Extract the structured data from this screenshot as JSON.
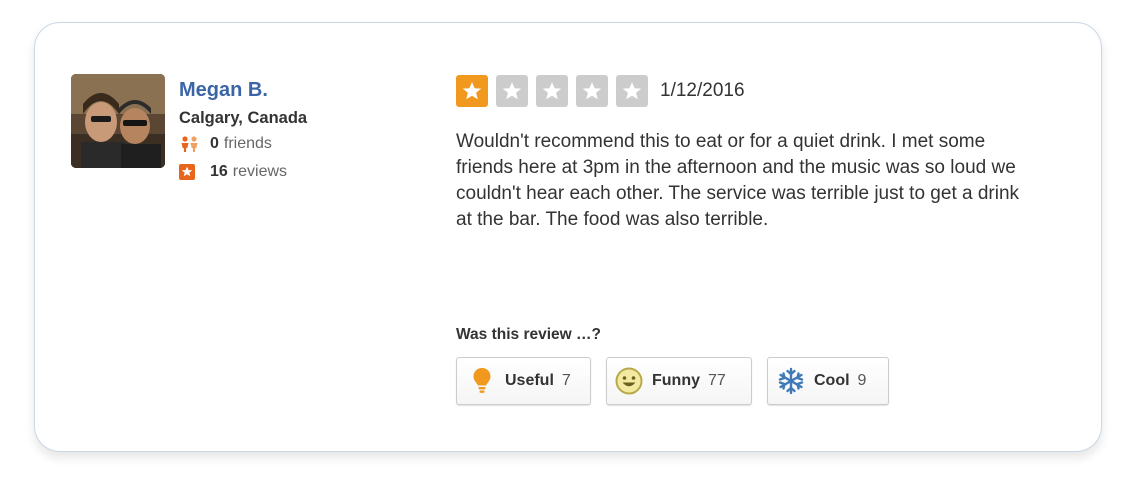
{
  "reviewer": {
    "name": "Megan B.",
    "location": "Calgary, Canada",
    "friends_count": "0",
    "friends_label": "friends",
    "reviews_count": "16",
    "reviews_label": "reviews"
  },
  "review": {
    "rating": 1,
    "max_rating": 5,
    "date": "1/12/2016",
    "text": "Wouldn't recommend this to eat or for a quiet drink. I met some friends here at 3pm in the afternoon and the music was so loud we couldn't hear each other. The service was terrible just to get a drink at the bar. The food was also terrible."
  },
  "votes": {
    "prompt": "Was this review …?",
    "useful": {
      "label": "Useful",
      "count": "7",
      "icon": "lightbulb-icon"
    },
    "funny": {
      "label": "Funny",
      "count": "77",
      "icon": "smiley-icon"
    },
    "cool": {
      "label": "Cool",
      "count": "9",
      "icon": "snowflake-icon"
    }
  },
  "colors": {
    "name_link": "#3b65a7",
    "star_filled": "#f0991e",
    "star_empty": "#cccccc",
    "accent_orange": "#e8651c",
    "card_border": "#c9d8e6"
  }
}
